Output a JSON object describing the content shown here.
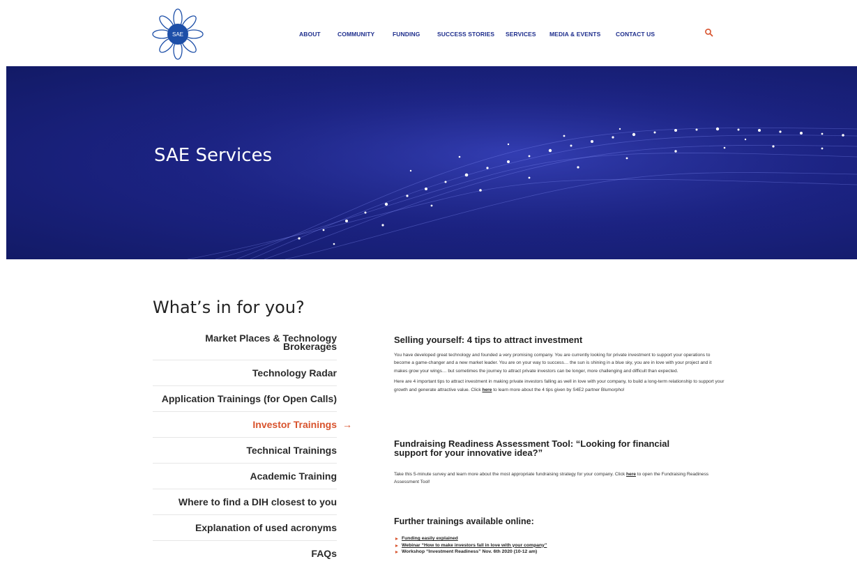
{
  "brand": {
    "logo_text": "SAE"
  },
  "nav": [
    {
      "label": "ABOUT"
    },
    {
      "label": "COMMUNITY"
    },
    {
      "label": "FUNDING"
    },
    {
      "label": "SUCCESS STORIES"
    },
    {
      "label": "SERVICES"
    },
    {
      "label": "MEDIA & EVENTS"
    },
    {
      "label": "CONTACT US"
    }
  ],
  "hero": {
    "title": "SAE Services"
  },
  "section": {
    "title": "What’s in for you?"
  },
  "menu": [
    {
      "label": "Market Places & Technology Brokerages"
    },
    {
      "label": "Technology Radar"
    },
    {
      "label": "Application Trainings (for Open Calls)"
    },
    {
      "label": "Investor Trainings"
    },
    {
      "label": "Technical Trainings"
    },
    {
      "label": "Academic Training"
    },
    {
      "label": "Where to find a DIH closest to you"
    },
    {
      "label": "Explanation of used acronyms"
    },
    {
      "label": "FAQs"
    }
  ],
  "active_arrow": "→",
  "content": {
    "h1": "Selling yourself: 4 tips to attract investment",
    "p1": "You have developed great technology and founded a very promising company. You are currently looking for private investment to support your operations to become a game-changer and a new market leader. You are on your way to success… the sun is shining in a blue sky, you are in love with your project and it makes grow your wings… but sometimes the journey to attract private investors can be longer, more challenging and difficult than expected.",
    "p2_a": "Here are 4 important tips to attract investment in making private investors falling as well in love with your company, to build a long-term relationship to support your growth and generate attractive value. Click ",
    "p2_link": "here",
    "p2_b": " to learn more about the 4 tips given by S4E2 partner Blumorpho!",
    "h2": "Fundraising Readiness Assessment Tool: “Looking for financial support for your innovative idea?”",
    "p3_a": "Take this 5-minute survey and learn more about the most appropriate fundraising strategy for your company. Click ",
    "p3_link": "here",
    "p3_b": " to open the Fundraising Readiness Assessment Tool!",
    "h3": "Further trainings available online:",
    "bullets": [
      "Funding easily explained",
      "Webinar “How to make investors fall in love with your company”",
      "Workshop “Investment Readiness” Nov. 6th 2020 (10-12 am)"
    ]
  },
  "colors": {
    "nav": "#1d2d8c",
    "accent": "#d8532d",
    "hero": "#1c2384",
    "logo": "#1d4fa8"
  }
}
